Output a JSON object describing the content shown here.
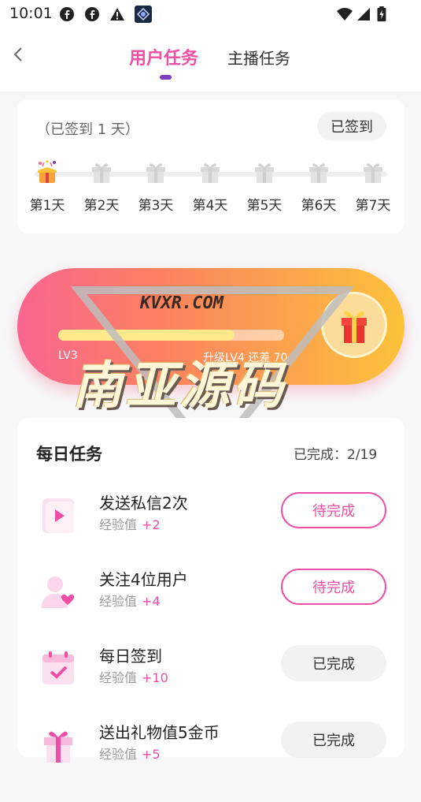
{
  "status_bar": {
    "time": "10:01",
    "icons": [
      "facebook-icon",
      "facebook-icon",
      "alert-icon",
      "app-icon",
      "wifi-icon",
      "signal-icon",
      "battery-icon"
    ]
  },
  "header": {
    "back_icon": "chevron-left-icon",
    "tabs": [
      {
        "label": "用户任务",
        "active": true
      },
      {
        "label": "主播任务",
        "active": false
      }
    ]
  },
  "checkin": {
    "days_text": "（已签到 1 天）",
    "button_label": "已签到",
    "days": [
      {
        "label": "第1天",
        "done": true
      },
      {
        "label": "第2天",
        "done": false
      },
      {
        "label": "第3天",
        "done": false
      },
      {
        "label": "第4天",
        "done": false
      },
      {
        "label": "第5天",
        "done": false
      },
      {
        "label": "第6天",
        "done": false
      },
      {
        "label": "第7天",
        "done": false
      }
    ]
  },
  "level": {
    "current": "LV3",
    "next_text": "升级LV4 还差 70",
    "progress": 0.78
  },
  "watermark": {
    "top": "KVXR.COM",
    "main": "南亚源码"
  },
  "daily": {
    "title": "每日任务",
    "progress_text": "已完成：2/19",
    "tasks": [
      {
        "name": "发送私信2次",
        "exp_label": "经验值",
        "exp": "+2",
        "button": "待完成",
        "status": "pending",
        "icon": "play-icon"
      },
      {
        "name": "关注4位用户",
        "exp_label": "经验值",
        "exp": "+4",
        "button": "待完成",
        "status": "pending",
        "icon": "user-heart-icon"
      },
      {
        "name": "每日签到",
        "exp_label": "经验值",
        "exp": "+10",
        "button": "已完成",
        "status": "done",
        "icon": "calendar-check-icon"
      },
      {
        "name": "送出礼物值5金币",
        "exp_label": "经验值",
        "exp": "+5",
        "button": "已完成",
        "status": "done",
        "icon": "gift-icon"
      }
    ]
  },
  "colors": {
    "accent": "#ee4fa4",
    "indicator": "#7b3cc2",
    "gradient_start": "#f96590",
    "gradient_end": "#fcc23a"
  }
}
